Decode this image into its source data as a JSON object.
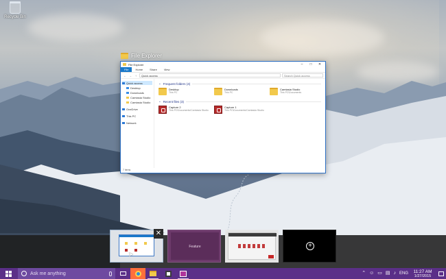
{
  "desktop": {
    "recycle_bin_label": "Recycle Bin"
  },
  "task_view": {
    "active_title": "File Explorer",
    "thumbnails": [
      {
        "name": "File Explorer"
      },
      {
        "name": "Feature",
        "label": "Feature"
      },
      {
        "name": "Camtasia Studio"
      },
      {
        "name": "New desktop",
        "icon": "plus-icon"
      }
    ],
    "close_glyph": "✕",
    "plus_glyph": "+"
  },
  "file_explorer": {
    "title": "File Explorer",
    "win_buttons": [
      "–",
      "□",
      "✕"
    ],
    "ribbon_tabs": [
      "File",
      "Home",
      "Share",
      "View"
    ],
    "address": "Quick access",
    "search_placeholder": "Search Quick access",
    "nav": [
      {
        "label": "Quick access",
        "icon": "star-icon",
        "color": "#2b79d6",
        "selected": true,
        "indent": false
      },
      {
        "label": "Desktop",
        "icon": "folder-icon",
        "color": "#3a8ee6",
        "indent": true
      },
      {
        "label": "Downloads",
        "icon": "download-icon",
        "color": "#3a8ee6",
        "indent": true
      },
      {
        "label": "Camtasia Studio",
        "icon": "folder-icon",
        "color": "#f2c94c",
        "indent": true
      },
      {
        "label": "Camtasia Studio",
        "icon": "folder-icon",
        "color": "#f2c94c",
        "indent": true
      },
      {
        "gap": true
      },
      {
        "label": "OneDrive",
        "icon": "cloud-icon",
        "color": "#2b79d6",
        "indent": false
      },
      {
        "gap": true
      },
      {
        "label": "This PC",
        "icon": "pc-icon",
        "color": "#2b79d6",
        "indent": false
      },
      {
        "gap": true
      },
      {
        "label": "Network",
        "icon": "network-icon",
        "color": "#2b79d6",
        "indent": false
      }
    ],
    "frequent_header": "Frequent folders (4)",
    "frequent": [
      {
        "name": "Desktop",
        "sub": "This PC"
      },
      {
        "name": "Downloads",
        "sub": "This PC"
      },
      {
        "name": "Camtasia Studio",
        "sub": "This PC\\Documents"
      }
    ],
    "recent_header": "Recent files (3)",
    "recent": [
      {
        "name": "Capture 2",
        "sub": "This PC\\Documents\\Camtasia Studio"
      },
      {
        "name": "Capture 1",
        "sub": "This PC\\Documents\\Camtasia Studio"
      }
    ],
    "status": "7 items"
  },
  "taskbar": {
    "search_placeholder": "Ask me anything",
    "pinned": [
      {
        "name": "task-view",
        "icon": "task-view-icon",
        "active": false
      },
      {
        "name": "edge",
        "icon": "edge-icon",
        "active": true
      },
      {
        "name": "file-explorer",
        "icon": "folder-icon",
        "active": false,
        "running": true
      },
      {
        "name": "store",
        "icon": "store-icon",
        "active": false
      },
      {
        "name": "app",
        "icon": "app-icon",
        "active": false,
        "running": true
      }
    ],
    "tray": {
      "language": "ENG",
      "time": "11:27 AM",
      "date": "1/27/2015"
    },
    "colors": {
      "taskbar": "#5b2f88",
      "search": "#6e4aa0",
      "active": "#ff6f3c"
    }
  }
}
